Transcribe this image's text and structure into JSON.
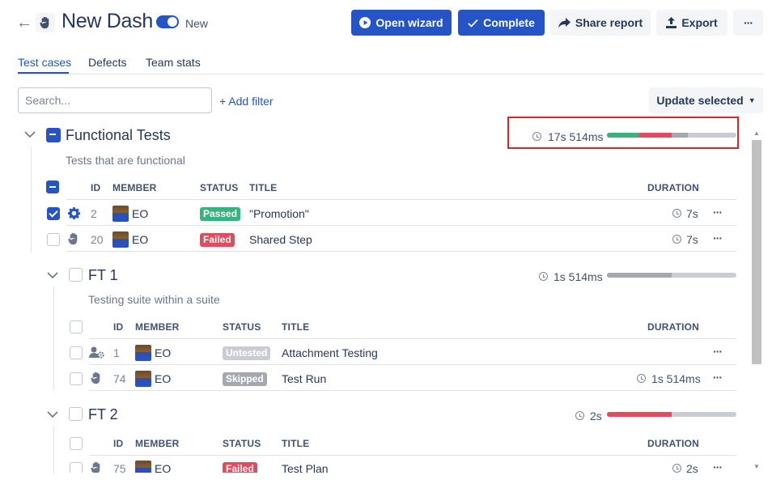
{
  "header": {
    "title": "New Dash",
    "toggle_label": "New",
    "buttons": {
      "open_wizard": "Open wizard",
      "complete": "Complete",
      "share_report": "Share report",
      "export": "Export",
      "more": "···"
    }
  },
  "tabs": [
    {
      "label": "Test cases",
      "active": true
    },
    {
      "label": "Defects",
      "active": false
    },
    {
      "label": "Team stats",
      "active": false
    }
  ],
  "toolbar": {
    "search_placeholder": "Search...",
    "add_filter": "+ Add filter",
    "update_selected": "Update selected"
  },
  "columns": {
    "id": "ID",
    "member": "MEMBER",
    "status": "STATUS",
    "title": "TITLE",
    "duration": "DURATION"
  },
  "suites": [
    {
      "title": "Functional Tests",
      "description": "Tests that are functional",
      "duration": "17s 514ms",
      "bar": {
        "passed": 0.25,
        "failed": 0.25,
        "skipped": 0.125
      },
      "rows": [
        {
          "icon": "gear-icon",
          "id": "2",
          "member": "EO",
          "status": "Passed",
          "title": "\"Promotion\"",
          "duration": "7s",
          "checked": true
        },
        {
          "icon": "hand-icon",
          "id": "20",
          "member": "EO",
          "status": "Failed",
          "title": "Shared Step",
          "duration": "7s",
          "checked": false
        }
      ]
    },
    {
      "title": "FT 1",
      "description": "Testing suite within a suite",
      "duration": "1s 514ms",
      "bar": {
        "passed": 0,
        "failed": 0,
        "skipped": 0.5
      },
      "rows": [
        {
          "icon": "user-gear-icon",
          "id": "1",
          "member": "EO",
          "status": "Untested",
          "title": "Attachment Testing",
          "duration": "",
          "checked": false
        },
        {
          "icon": "hand-icon",
          "id": "74",
          "member": "EO",
          "status": "Skipped",
          "title": "Test Run",
          "duration": "1s 514ms",
          "checked": false
        }
      ]
    },
    {
      "title": "FT 2",
      "description": "",
      "duration": "2s",
      "bar": {
        "passed": 0,
        "failed": 0.5,
        "skipped": 0
      },
      "rows": [
        {
          "icon": "hand-icon",
          "id": "75",
          "member": "EO",
          "status": "Failed",
          "title": "Test Plan",
          "duration": "2s",
          "checked": false
        }
      ]
    }
  ],
  "colors": {
    "accent": "#2454c6",
    "passed": "#36b37e",
    "failed": "#e5495e",
    "skipped": "#a5a9ae",
    "untested": "#c9cdd3",
    "highlight": "#d62828"
  }
}
